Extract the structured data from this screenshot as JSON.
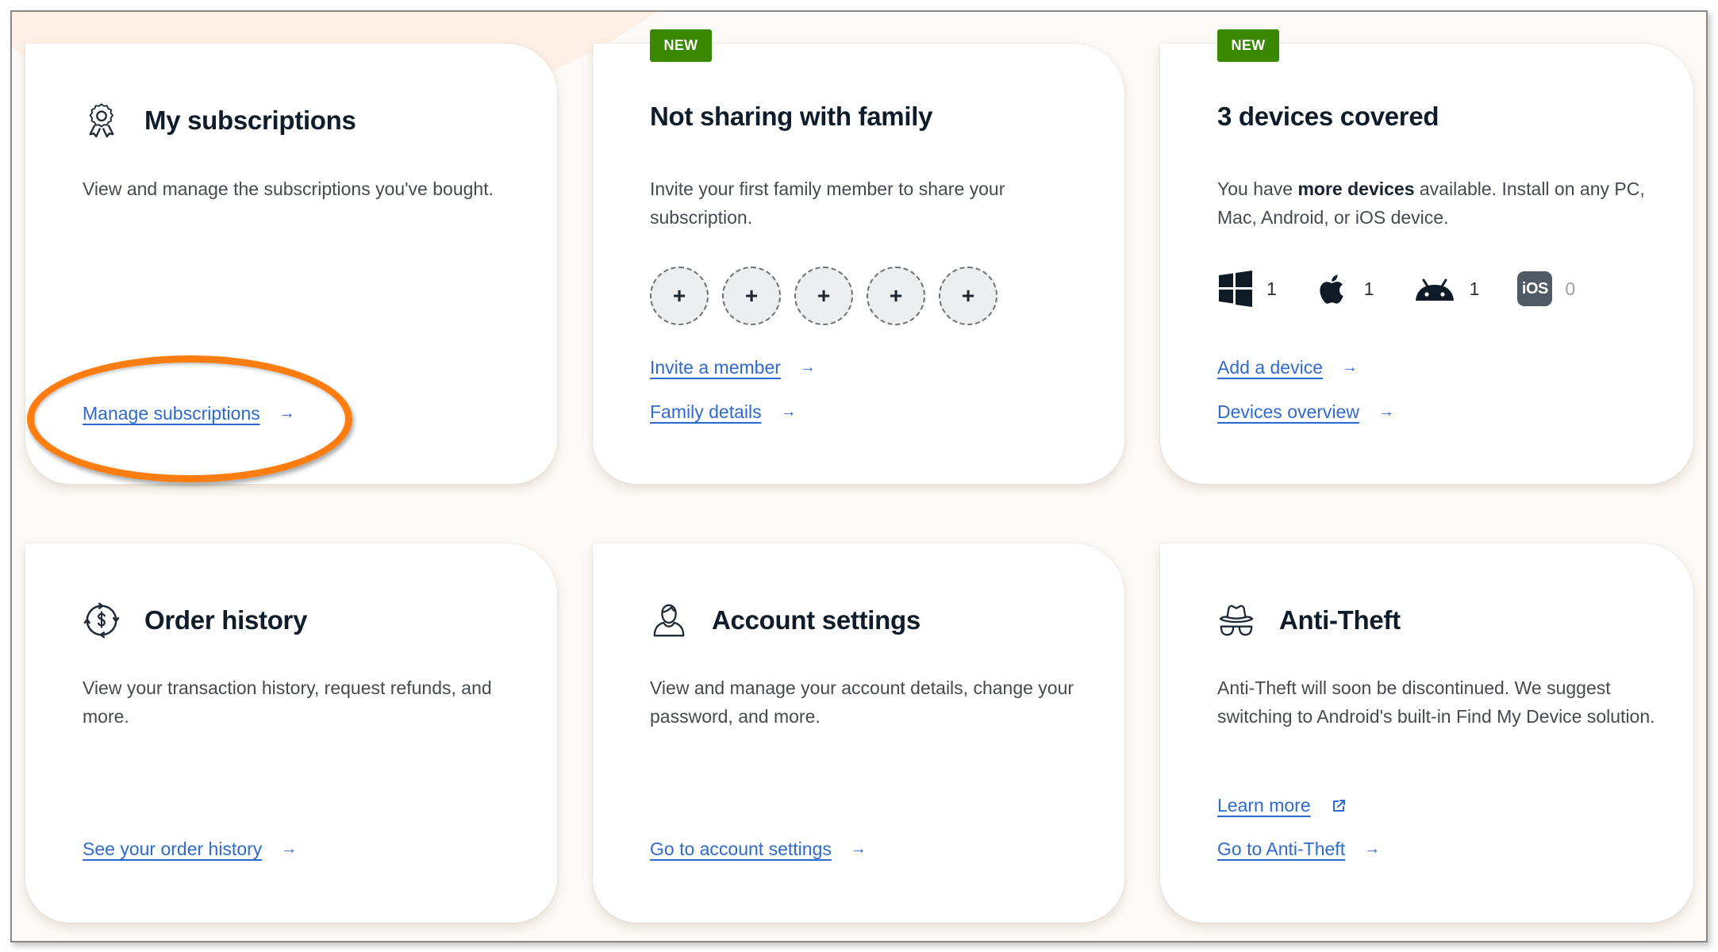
{
  "cards": {
    "subscriptions": {
      "icon": "award-ribbon-icon",
      "title": "My subscriptions",
      "description": "View and manage the subscriptions you've bought.",
      "links": [
        {
          "label": "Manage subscriptions",
          "icon": "arrow-right-icon",
          "glyph": "→"
        }
      ],
      "highlighted_link": "Manage subscriptions"
    },
    "family": {
      "badge": "NEW",
      "title": "Not sharing with family",
      "description": "Invite your first family member to share your subscription.",
      "member_slots": [
        "+",
        "+",
        "+",
        "+",
        "+"
      ],
      "links": [
        {
          "label": "Invite a member",
          "glyph": "→"
        },
        {
          "label": "Family details",
          "glyph": "→"
        }
      ]
    },
    "devices": {
      "badge": "NEW",
      "title": "3 devices covered",
      "description_prefix": "You have ",
      "description_bold": "more devices",
      "description_suffix": " available. Install on any PC, Mac, Android, or iOS device.",
      "platforms": [
        {
          "name": "Windows",
          "icon": "windows-icon",
          "count": "1"
        },
        {
          "name": "macOS",
          "icon": "apple-icon",
          "count": "1"
        },
        {
          "name": "Android",
          "icon": "android-icon",
          "count": "1"
        },
        {
          "name": "iOS",
          "icon": "ios-icon",
          "label": "iOS",
          "count": "0"
        }
      ],
      "links": [
        {
          "label": "Add a device",
          "glyph": "→"
        },
        {
          "label": "Devices overview",
          "glyph": "→"
        }
      ]
    },
    "orders": {
      "icon": "dollar-cycle-icon",
      "title": "Order history",
      "description": "View your transaction history, request refunds, and more.",
      "links": [
        {
          "label": "See your order history",
          "glyph": "→"
        }
      ]
    },
    "account": {
      "icon": "user-icon",
      "title": "Account settings",
      "description": "View and manage your account details, change your password, and more.",
      "links": [
        {
          "label": "Go to account settings",
          "glyph": "→"
        }
      ]
    },
    "antitheft": {
      "icon": "incognito-hat-glasses-icon",
      "title": "Anti-Theft",
      "description": "Anti-Theft will soon be discontinued. We suggest switching to Android's built-in Find My Device solution.",
      "links": [
        {
          "label": "Learn more",
          "icon": "external-link-icon"
        },
        {
          "label": "Go to Anti-Theft",
          "glyph": "→"
        }
      ]
    }
  },
  "colors": {
    "link": "#2f6ad0",
    "badge_green": "#3a8700",
    "highlight_orange": "#ff7d0f",
    "title": "#0f1d2b",
    "background_peach": "#fdf1e7"
  }
}
